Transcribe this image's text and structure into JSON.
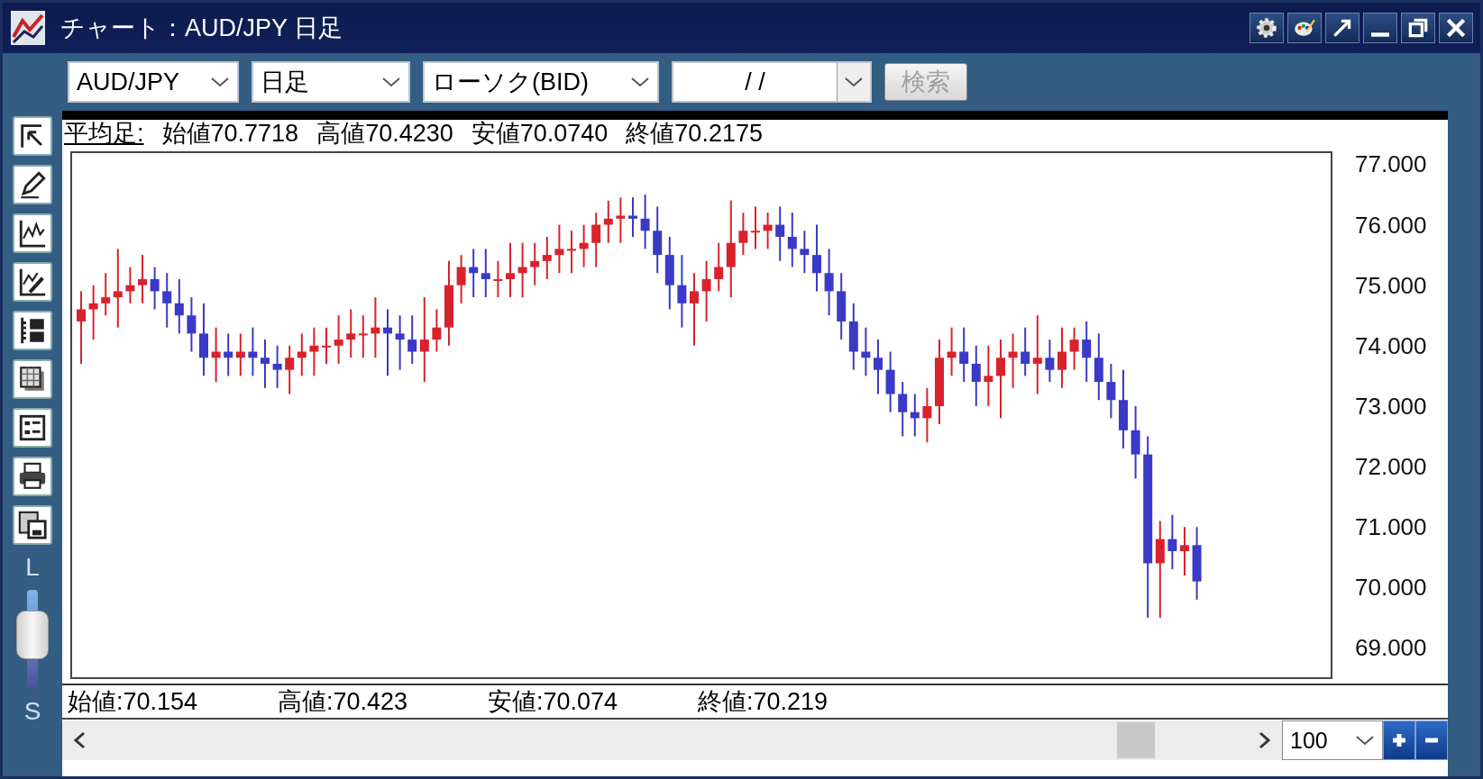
{
  "window": {
    "title": "チャート：AUD/JPY 日足"
  },
  "toolbar": {
    "selects": [
      {
        "value": "AUD/JPY"
      },
      {
        "value": "日足"
      },
      {
        "value": "ローソク(BID)"
      }
    ],
    "date_field": {
      "value": "/ /"
    },
    "search_button": {
      "label": "検索",
      "disabled": true
    }
  },
  "sidebar": {
    "slider": {
      "top_label": "L",
      "bottom_label": "S",
      "level": 0.55
    }
  },
  "info_line": {
    "label": "平均足:",
    "values": [
      "始値70.7718",
      "高値70.4230",
      "安値70.0740",
      "終値70.2175"
    ]
  },
  "chart": {
    "price_axis_labels": [
      "77.000",
      "76.000",
      "75.000",
      "74.000",
      "73.000",
      "72.000",
      "71.000",
      "70.000",
      "69.000"
    ]
  },
  "ohlc_line": [
    "始値:70.154",
    "高値:70.423",
    "安値:70.074",
    "終値:70.219"
  ],
  "bottom_bar": {
    "zoom_select": {
      "value": "100"
    }
  }
}
